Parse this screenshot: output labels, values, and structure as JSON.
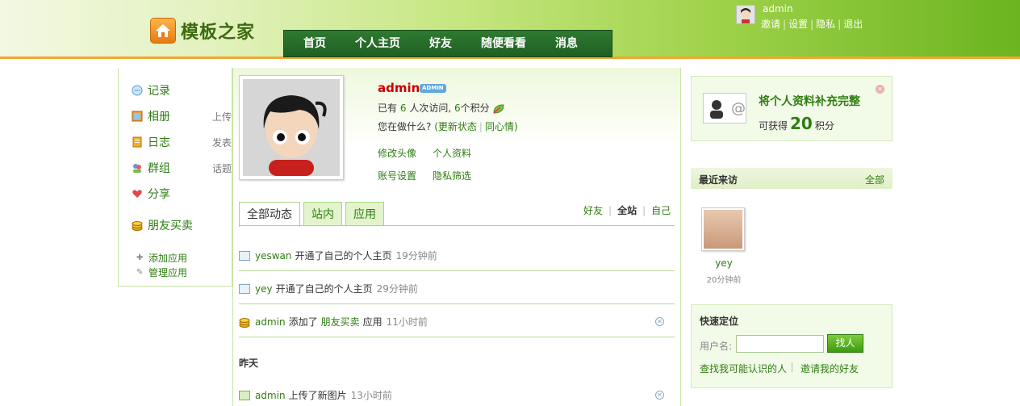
{
  "header": {
    "logo_text": "模板之家",
    "nav": [
      "首页",
      "个人主页",
      "好友",
      "随便看看",
      "消息"
    ],
    "user": {
      "name": "admin",
      "links": [
        "邀请",
        "设置",
        "隐私",
        "退出"
      ]
    }
  },
  "sidebar": {
    "items": [
      {
        "label": "记录",
        "sub": "",
        "icon": "chat-bubble-icon"
      },
      {
        "label": "相册",
        "sub": "上传",
        "icon": "photo-album-icon"
      },
      {
        "label": "日志",
        "sub": "发表",
        "icon": "notebook-icon"
      },
      {
        "label": "群组",
        "sub": "话题",
        "icon": "group-icon"
      },
      {
        "label": "分享",
        "sub": "",
        "icon": "heart-share-icon"
      },
      {
        "label": "朋友买卖",
        "sub": "",
        "icon": "coins-icon"
      }
    ],
    "add_app": "添加应用",
    "manage_app": "管理应用"
  },
  "profile": {
    "name": "admin",
    "badge": "ADMIN",
    "stats_prefix": "已有",
    "visits": "6",
    "visits_suffix": "人次访问,",
    "points": "6",
    "points_suffix": "个积分",
    "status_question": "您在做什么?",
    "update_status": "(更新状态",
    "same_mood": "同心情)",
    "links": [
      "修改头像",
      "个人资料",
      "账号设置",
      "隐私筛选"
    ]
  },
  "feed": {
    "tabs": [
      "全部动态",
      "站内",
      "应用"
    ],
    "filters": [
      "好友",
      "全站",
      "自己"
    ],
    "items": [
      {
        "user": "yeswan",
        "action": "开通了自己的个人主页",
        "time": "19分钟前"
      },
      {
        "user": "yey",
        "action": "开通了自己的个人主页",
        "time": "29分钟前"
      },
      {
        "user": "admin",
        "action_pre": "添加了",
        "app": "朋友买卖",
        "action_post": "应用",
        "time": "11小时前"
      }
    ],
    "yesterday_label": "昨天",
    "yesterday_item": {
      "user": "admin",
      "action": "上传了新图片",
      "time": "13小时前"
    }
  },
  "right": {
    "complete_title": "将个人资料补充完整",
    "complete_prefix": "可获得",
    "complete_points": "20",
    "complete_suffix": "积分",
    "visits_title": "最近来访",
    "visits_all": "全部",
    "visitor": {
      "name": "yey",
      "time": "20分钟前"
    },
    "locate_title": "快速定位",
    "username_label": "用户名:",
    "find_button": "找人",
    "find_known": "查找我可能认识的人",
    "invite_friends": "邀请我的好友"
  }
}
